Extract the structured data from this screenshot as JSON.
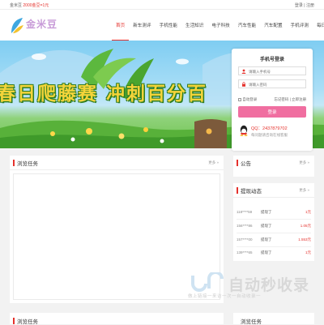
{
  "topbar": {
    "welcome": "金米豆",
    "promo": "2000金豆=1元",
    "login": "登录",
    "sep": "|",
    "register": "注册"
  },
  "logo": {
    "text": "金米豆"
  },
  "nav": {
    "items": [
      "首页",
      "新车测评",
      "手机性能",
      "生活知识",
      "电子科技",
      "汽车性能",
      "汽车配置",
      "手机评测",
      "每日活动"
    ],
    "active_index": 0
  },
  "banner": {
    "title": "春日爬藤赛 冲刺百分百"
  },
  "login": {
    "title": "手机号登录",
    "phone_placeholder": "请输入手机号",
    "password_placeholder": "请输入密码",
    "remember": "自动登录",
    "forgot": "忘记密码 | 立即注册",
    "button": "登录",
    "qq": "QQ：2437879702",
    "qq_note": "每问题请咨询在线客服"
  },
  "browse": {
    "title": "浏览任务",
    "more": "更多 »"
  },
  "notice": {
    "title": "公告",
    "more": "更多 »"
  },
  "withdraw": {
    "title": "提现动态",
    "more": "更多 »",
    "rows": [
      {
        "user": "118****59",
        "action": "提现了",
        "amount": "1元"
      },
      {
        "user": "156****86",
        "action": "提现了",
        "amount": "1.05元"
      },
      {
        "user": "157****00",
        "action": "提现了",
        "amount": "1.553元"
      },
      {
        "user": "139****65",
        "action": "提现了",
        "amount": "1元"
      }
    ]
  },
  "bottom": {
    "left_title": "浏览任务",
    "right_title": "浏览任务"
  },
  "watermark": {
    "text": "自动秒收录",
    "sub": "做上链接一来访一次一自动收录一"
  },
  "colors": {
    "accent": "#e5322d",
    "pink": "#f06ea0",
    "logo": "#c89bd8"
  }
}
